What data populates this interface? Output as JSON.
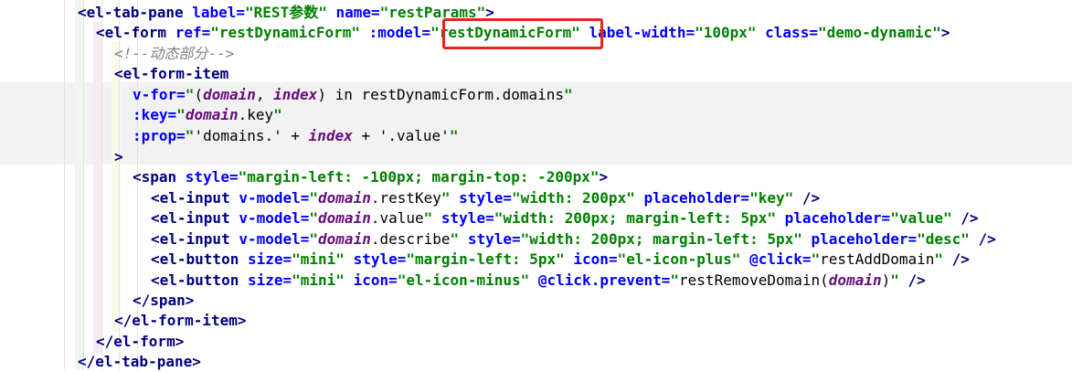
{
  "editor": {
    "lines": [
      {
        "id": "l01",
        "parts": [
          {
            "t": "<el-tab-pane ",
            "c": "tag"
          },
          {
            "t": "label=",
            "c": "attr"
          },
          {
            "t": "\"REST参数\"",
            "c": "str"
          },
          {
            "t": " ",
            "c": "plain"
          },
          {
            "t": "name=",
            "c": "attr"
          },
          {
            "t": "\"restParams\"",
            "c": "str"
          },
          {
            "t": ">",
            "c": "tag"
          }
        ]
      },
      {
        "id": "l02",
        "parts": [
          {
            "t": "<el-form ",
            "c": "tag"
          },
          {
            "t": "ref=",
            "c": "attr"
          },
          {
            "t": "\"restDynamicForm\"",
            "c": "str"
          },
          {
            "t": " ",
            "c": "plain"
          },
          {
            "t": ":model=",
            "c": "attr"
          },
          {
            "t": "\"restDynamicForm\"",
            "c": "str"
          },
          {
            "t": " ",
            "c": "plain"
          },
          {
            "t": "label-width=",
            "c": "attr"
          },
          {
            "t": "\"100px\"",
            "c": "str"
          },
          {
            "t": " ",
            "c": "plain"
          },
          {
            "t": "class=",
            "c": "attr"
          },
          {
            "t": "\"demo-dynamic\"",
            "c": "str"
          },
          {
            "t": ">",
            "c": "tag"
          }
        ]
      },
      {
        "id": "l03",
        "parts": [
          {
            "t": "<!--动态部分-->",
            "c": "cmt"
          }
        ]
      },
      {
        "id": "l04",
        "parts": [
          {
            "t": "<el-form-item",
            "c": "tag"
          }
        ]
      },
      {
        "id": "l05",
        "parts": [
          {
            "t": "v-for=",
            "c": "attr"
          },
          {
            "t": "\"",
            "c": "str"
          },
          {
            "t": "(",
            "c": "code"
          },
          {
            "t": "domain",
            "c": "var"
          },
          {
            "t": ", ",
            "c": "code"
          },
          {
            "t": "index",
            "c": "var"
          },
          {
            "t": ") in restDynamicForm.domains",
            "c": "code"
          },
          {
            "t": "\"",
            "c": "str"
          }
        ]
      },
      {
        "id": "l06",
        "parts": [
          {
            "t": ":key=",
            "c": "attr"
          },
          {
            "t": "\"",
            "c": "str"
          },
          {
            "t": "domain",
            "c": "var"
          },
          {
            "t": ".key",
            "c": "code"
          },
          {
            "t": "\"",
            "c": "str"
          }
        ]
      },
      {
        "id": "l07",
        "parts": [
          {
            "t": ":prop=",
            "c": "attr"
          },
          {
            "t": "\"",
            "c": "str"
          },
          {
            "t": "'domains.' + ",
            "c": "code"
          },
          {
            "t": "index",
            "c": "var"
          },
          {
            "t": " + '.value'",
            "c": "code"
          },
          {
            "t": "\"",
            "c": "str"
          }
        ]
      },
      {
        "id": "l08",
        "parts": [
          {
            "t": ">",
            "c": "tag"
          }
        ]
      },
      {
        "id": "l09",
        "parts": [
          {
            "t": "<span ",
            "c": "tag"
          },
          {
            "t": "style=",
            "c": "attr"
          },
          {
            "t": "\"margin-left: -100px; margin-top: -200px\"",
            "c": "str"
          },
          {
            "t": ">",
            "c": "tag"
          }
        ]
      },
      {
        "id": "l10",
        "parts": [
          {
            "t": "<el-input ",
            "c": "tag"
          },
          {
            "t": "v-model=",
            "c": "attr"
          },
          {
            "t": "\"",
            "c": "str"
          },
          {
            "t": "domain",
            "c": "var"
          },
          {
            "t": ".restKey",
            "c": "code"
          },
          {
            "t": "\"",
            "c": "str"
          },
          {
            "t": " ",
            "c": "plain"
          },
          {
            "t": "style=",
            "c": "attr"
          },
          {
            "t": "\"width: 200px\"",
            "c": "str"
          },
          {
            "t": " ",
            "c": "plain"
          },
          {
            "t": "placeholder=",
            "c": "attr"
          },
          {
            "t": "\"key\"",
            "c": "str"
          },
          {
            "t": " />",
            "c": "tag"
          }
        ]
      },
      {
        "id": "l11",
        "parts": [
          {
            "t": "<el-input ",
            "c": "tag"
          },
          {
            "t": "v-model=",
            "c": "attr"
          },
          {
            "t": "\"",
            "c": "str"
          },
          {
            "t": "domain",
            "c": "var"
          },
          {
            "t": ".value",
            "c": "code"
          },
          {
            "t": "\"",
            "c": "str"
          },
          {
            "t": " ",
            "c": "plain"
          },
          {
            "t": "style=",
            "c": "attr"
          },
          {
            "t": "\"width: 200px; margin-left: 5px\"",
            "c": "str"
          },
          {
            "t": " ",
            "c": "plain"
          },
          {
            "t": "placeholder=",
            "c": "attr"
          },
          {
            "t": "\"value\"",
            "c": "str"
          },
          {
            "t": " />",
            "c": "tag"
          }
        ]
      },
      {
        "id": "l12",
        "parts": [
          {
            "t": "<el-input ",
            "c": "tag"
          },
          {
            "t": "v-model=",
            "c": "attr"
          },
          {
            "t": "\"",
            "c": "str"
          },
          {
            "t": "domain",
            "c": "var"
          },
          {
            "t": ".describe",
            "c": "code"
          },
          {
            "t": "\"",
            "c": "str"
          },
          {
            "t": " ",
            "c": "plain"
          },
          {
            "t": "style=",
            "c": "attr"
          },
          {
            "t": "\"width: 200px; margin-left: 5px\"",
            "c": "str"
          },
          {
            "t": " ",
            "c": "plain"
          },
          {
            "t": "placeholder=",
            "c": "attr"
          },
          {
            "t": "\"desc\"",
            "c": "str"
          },
          {
            "t": " />",
            "c": "tag"
          }
        ]
      },
      {
        "id": "l13",
        "parts": [
          {
            "t": "<el-button ",
            "c": "tag"
          },
          {
            "t": "size=",
            "c": "attr"
          },
          {
            "t": "\"mini\"",
            "c": "str"
          },
          {
            "t": " ",
            "c": "plain"
          },
          {
            "t": "style=",
            "c": "attr"
          },
          {
            "t": "\"margin-left: 5px\"",
            "c": "str"
          },
          {
            "t": " ",
            "c": "plain"
          },
          {
            "t": "icon=",
            "c": "attr"
          },
          {
            "t": "\"el-icon-plus\"",
            "c": "str"
          },
          {
            "t": " ",
            "c": "plain"
          },
          {
            "t": "@click=",
            "c": "attr"
          },
          {
            "t": "\"",
            "c": "str"
          },
          {
            "t": "restAddDomain",
            "c": "code"
          },
          {
            "t": "\"",
            "c": "str"
          },
          {
            "t": " />",
            "c": "tag"
          }
        ]
      },
      {
        "id": "l14",
        "parts": [
          {
            "t": "<el-button ",
            "c": "tag"
          },
          {
            "t": "size=",
            "c": "attr"
          },
          {
            "t": "\"mini\"",
            "c": "str"
          },
          {
            "t": " ",
            "c": "plain"
          },
          {
            "t": "icon=",
            "c": "attr"
          },
          {
            "t": "\"el-icon-minus\"",
            "c": "str"
          },
          {
            "t": " ",
            "c": "plain"
          },
          {
            "t": "@click.prevent=",
            "c": "attr"
          },
          {
            "t": "\"",
            "c": "str"
          },
          {
            "t": "restRemoveDomain(",
            "c": "code"
          },
          {
            "t": "domain",
            "c": "var"
          },
          {
            "t": ")",
            "c": "code"
          },
          {
            "t": "\"",
            "c": "str"
          },
          {
            "t": " />",
            "c": "tag"
          }
        ]
      },
      {
        "id": "l15",
        "parts": [
          {
            "t": "</span>",
            "c": "tag"
          }
        ]
      },
      {
        "id": "l16",
        "parts": [
          {
            "t": "</el-form-item>",
            "c": "tag"
          }
        ]
      },
      {
        "id": "l17",
        "parts": [
          {
            "t": "</el-form>",
            "c": "tag"
          }
        ]
      },
      {
        "id": "l18",
        "parts": [
          {
            "t": "</el-tab-pane>",
            "c": "tag"
          }
        ]
      }
    ]
  },
  "colors": {
    "tag": "#000080",
    "attribute": "#0000ff",
    "string": "#008000",
    "variable": "#660e7a",
    "comment": "#808080",
    "annotation_box": "#e5261f"
  }
}
